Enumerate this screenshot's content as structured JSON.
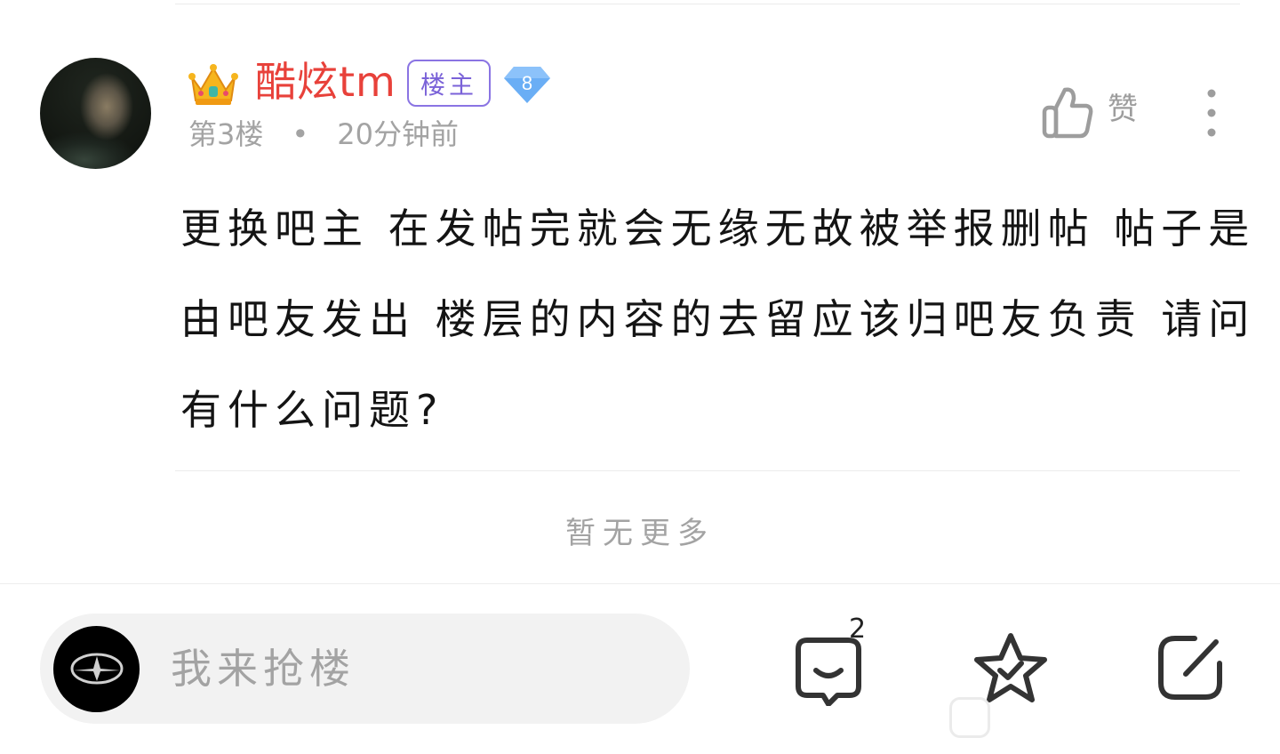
{
  "post": {
    "username": "酷炫tm",
    "op_badge": "楼主",
    "level": "8",
    "floor": "第3楼",
    "separator": "•",
    "time": "20分钟前",
    "like_label": "赞",
    "content": "更换吧主 在发帖完就会无缘无故被举报删帖 帖子是由吧友发出 楼层的内容的去留应该归吧友负责 请问有什么问题?"
  },
  "list_end_text": "暂无更多",
  "bottom_bar": {
    "reply_placeholder": "我来抢楼",
    "comment_count": "2"
  },
  "colors": {
    "username": "#e8413a",
    "op_badge": "#7a62d8",
    "level_badge": "#6aaef5",
    "muted_text": "#a3a3a3"
  },
  "icons": {
    "crown": "crown-icon",
    "level": "diamond-level-icon",
    "like": "thumbs-up-icon",
    "more": "more-vertical-icon",
    "comment": "comment-smile-icon",
    "favorite": "star-check-icon",
    "share": "share-edit-icon"
  }
}
